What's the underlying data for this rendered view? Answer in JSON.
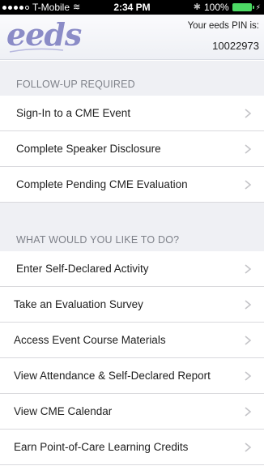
{
  "status_bar": {
    "carrier": "T-Mobile",
    "time": "2:34 PM",
    "battery": "100%"
  },
  "header": {
    "logo_text": "eeds",
    "pin_label": "Your eeds PIN is:",
    "pin_value": "10022973"
  },
  "sections": [
    {
      "title": "FOLLOW-UP REQUIRED",
      "items": [
        {
          "label": "Sign-In to a CME Event"
        },
        {
          "label": "Complete Speaker Disclosure"
        },
        {
          "label": "Complete Pending CME Evaluation"
        }
      ]
    },
    {
      "title": "WHAT WOULD YOU LIKE TO DO?",
      "items": [
        {
          "label": "Enter Self-Declared Activity"
        },
        {
          "label": "Take an Evaluation Survey"
        },
        {
          "label": "Access Event Course Materials"
        },
        {
          "label": "View Attendance & Self-Declared Report"
        },
        {
          "label": "View CME Calendar"
        },
        {
          "label": "Earn Point-of-Care Learning Credits"
        }
      ]
    }
  ],
  "colors": {
    "logo": "#8b8cc7",
    "section_bg": "#eff0f4",
    "battery": "#4cd964"
  }
}
